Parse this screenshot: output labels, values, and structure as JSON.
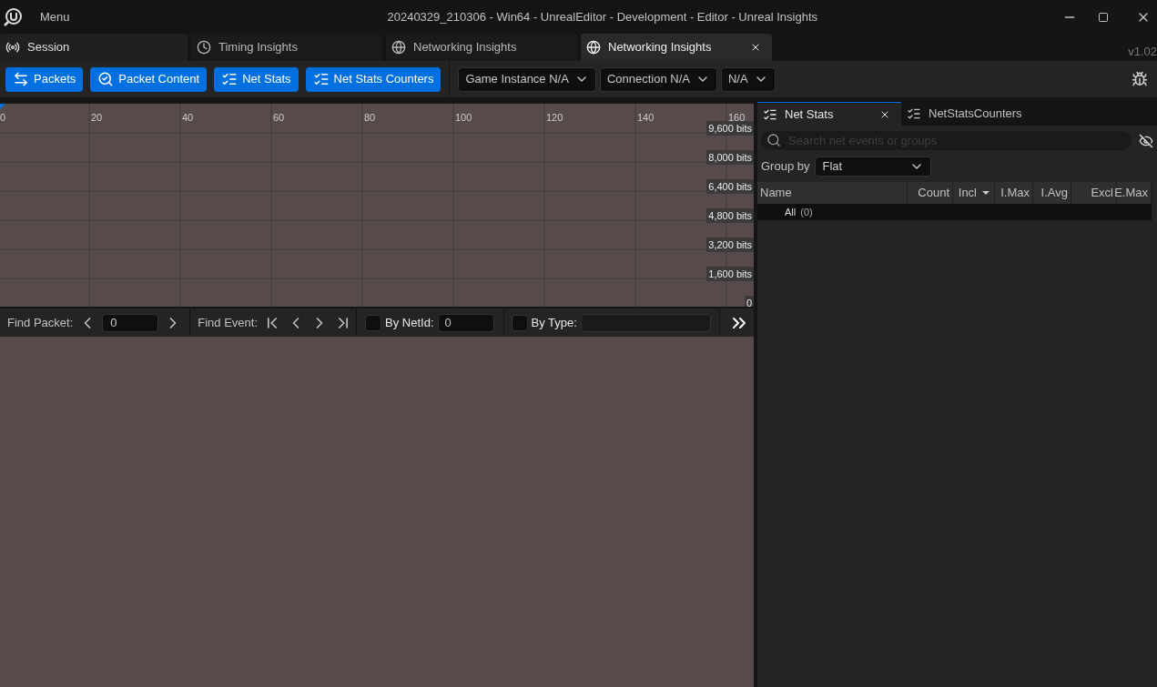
{
  "menu": "Menu",
  "window": {
    "title": "20240329_210306 - Win64 - UnrealEditor - Development - Editor - Unreal Insights"
  },
  "tabs": [
    {
      "kind": "session",
      "label": "Session",
      "selected": false,
      "closable": false
    },
    {
      "kind": "timing",
      "label": "Timing Insights",
      "selected": false,
      "closable": false
    },
    {
      "kind": "network",
      "label": "Networking Insights",
      "selected": false,
      "closable": false
    },
    {
      "kind": "network",
      "label": "Networking Insights",
      "selected": true,
      "closable": true
    }
  ],
  "version": "v1.02",
  "toolbar_buttons": [
    {
      "kind": "packets",
      "label": "Packets"
    },
    {
      "kind": "content",
      "label": "Packet Content"
    },
    {
      "kind": "stats",
      "label": "Net Stats"
    },
    {
      "kind": "stats",
      "label": "Net Stats Counters"
    }
  ],
  "dropdowns": [
    "Game Instance N/A",
    "Connection N/A",
    "N/A"
  ],
  "graph": {
    "x_ticks": [
      "0",
      "20",
      "40",
      "60",
      "80",
      "100",
      "120",
      "140",
      "160"
    ],
    "y_ticks": [
      "9,600 bits",
      "8,000 bits",
      "6,400 bits",
      "4,800 bits",
      "3,200 bits",
      "1,600 bits",
      "0"
    ]
  },
  "find_bar": {
    "find_packet_label": "Find Packet:",
    "packet_value": "0",
    "find_event_label": "Find Event:",
    "by_netid": {
      "label": "By NetId:",
      "checked": false,
      "value": "0"
    },
    "by_type": {
      "label": "By Type:",
      "checked": false
    }
  },
  "side_tabs": [
    {
      "label": "Net Stats",
      "selected": true,
      "closable": true
    },
    {
      "label": "NetStatsCounters",
      "selected": false,
      "closable": false
    }
  ],
  "search": {
    "placeholder": "Search net events or groups"
  },
  "group_by": {
    "label": "Group by",
    "value": "Flat"
  },
  "table": {
    "columns": [
      {
        "label": "Name",
        "sorted": false
      },
      {
        "label": "Count",
        "sorted": false
      },
      {
        "label": "Incl",
        "sorted": true
      },
      {
        "label": "I.Max",
        "sorted": false
      },
      {
        "label": "I.Avg",
        "sorted": false
      },
      {
        "label": "Excl",
        "sorted": false
      },
      {
        "label": "E.Max",
        "sorted": false
      }
    ],
    "rows": [
      {
        "name": "All",
        "count": "(0)"
      }
    ]
  }
}
